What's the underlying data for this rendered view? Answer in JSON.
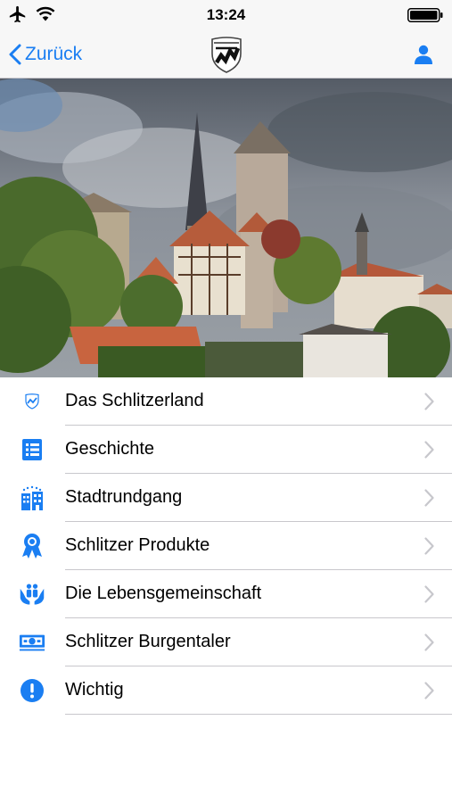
{
  "status_bar": {
    "time": "13:24"
  },
  "nav": {
    "back_label": "Zurück",
    "accent_color": "#1a7ef2"
  },
  "menu": {
    "items": [
      {
        "label": "Das Schlitzerland",
        "icon": "crest-icon"
      },
      {
        "label": "Geschichte",
        "icon": "document-list-icon"
      },
      {
        "label": "Stadtrundgang",
        "icon": "buildings-icon"
      },
      {
        "label": "Schlitzer Produkte",
        "icon": "award-ribbon-icon"
      },
      {
        "label": "Die Lebensgemeinschaft",
        "icon": "community-hands-icon"
      },
      {
        "label": "Schlitzer Burgentaler",
        "icon": "banknote-icon"
      },
      {
        "label": "Wichtig",
        "icon": "exclamation-icon"
      }
    ]
  }
}
